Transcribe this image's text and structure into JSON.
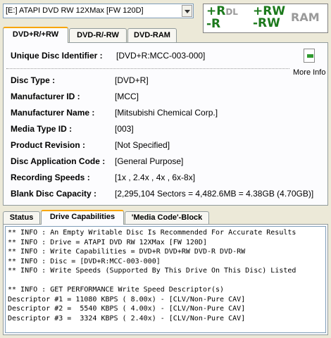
{
  "drive_selector": {
    "value": "[E:] ATAPI DVD RW 12XMax [FW 120D]"
  },
  "logos": {
    "rdl_line1": "+R",
    "rdl_dl": "DL",
    "rdl_line2": "-R",
    "rw_line1": "+RW",
    "rw_line2": "-RW",
    "ram": "RAM"
  },
  "top_tabs": [
    {
      "label": "DVD+R/+RW",
      "active": true
    },
    {
      "label": "DVD-R/-RW",
      "active": false
    },
    {
      "label": "DVD-RAM",
      "active": false
    }
  ],
  "disc_id": {
    "label": "Unique Disc Identifier :",
    "value": "[DVD+R:MCC-003-000]"
  },
  "more_info": {
    "label": "More Info"
  },
  "fields": [
    {
      "label": "Disc Type :",
      "value": "[DVD+R]"
    },
    {
      "label": "Manufacturer ID :",
      "value": "[MCC]"
    },
    {
      "label": "Manufacturer Name :",
      "value": "[Mitsubishi Chemical Corp.]"
    },
    {
      "label": "Media Type ID :",
      "value": "[003]"
    },
    {
      "label": "Product Revision :",
      "value": "[Not Specified]"
    },
    {
      "label": "Disc Application Code :",
      "value": "[General Purpose]"
    },
    {
      "label": "Recording Speeds :",
      "value": "[1x , 2.4x , 4x , 6x-8x]"
    },
    {
      "label": "Blank Disc Capacity :",
      "value": "[2,295,104 Sectors = 4,482.6MB = 4.38GB (4.70GB)]"
    }
  ],
  "bottom_tabs": [
    {
      "label": "Status",
      "active": false
    },
    {
      "label": "Drive Capabilities",
      "active": true
    },
    {
      "label": "'Media Code'-Block",
      "active": false
    }
  ],
  "log_lines": [
    "** INFO : An Empty Writable Disc Is Recommended For Accurate Results",
    "** INFO : Drive = ATAPI DVD RW 12XMax [FW 120D]",
    "** INFO : Write Capabilities = DVD+R DVD+RW DVD-R DVD-RW",
    "** INFO : Disc = [DVD+R:MCC-003-000]",
    "** INFO : Write Speeds (Supported By This Drive On This Disc) Listed",
    "",
    "** INFO : GET PERFORMANCE Write Speed Descriptor(s)",
    "Descriptor #1 = 11080 KBPS ( 8.00x) - [CLV/Non-Pure CAV]",
    "Descriptor #2 =  5540 KBPS ( 4.00x) - [CLV/Non-Pure CAV]",
    "Descriptor #3 =  3324 KBPS ( 2.40x) - [CLV/Non-Pure CAV]"
  ]
}
